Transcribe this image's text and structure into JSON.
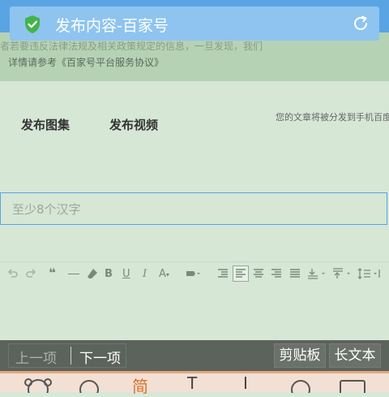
{
  "address_bar": {
    "title": "发布内容-百家号"
  },
  "notice": {
    "line1": "者若要违反法律法规及相关政策规定的信息，一旦发现，我们",
    "line2": "详情请参考《百家号平台服务协议》"
  },
  "tabs": {
    "gallery": "发布图集",
    "video": "发布视频"
  },
  "hint": "您的文章将被分发到手机百度",
  "title_input": {
    "placeholder": "至少8个汉字"
  },
  "editor_toolbar": {
    "icons": [
      "undo-icon",
      "redo-icon",
      "quote-icon",
      "hr-icon",
      "eraser-icon",
      "bold-icon",
      "underline-icon",
      "italic-icon",
      "font-color-icon",
      "highlight-icon",
      "indent-icon",
      "align-left-icon",
      "align-center-icon",
      "align-right-icon",
      "align-justify-icon",
      "row-spacing-top-icon",
      "row-spacing-bottom-icon",
      "line-height-icon"
    ],
    "bold": "B",
    "underline": "U",
    "italic": "I",
    "font_color": "A"
  },
  "keyboard_bar": {
    "prev": "上一项",
    "next": "下一项",
    "clipboard": "剪贴板",
    "long_text": "长文本"
  },
  "ime_bar": {
    "items": [
      "",
      "",
      "简",
      "T",
      "I",
      "",
      ""
    ]
  },
  "colors": {
    "accent": "#5aa4e3",
    "background": "#d6e7d6",
    "keyboard_bar": "#5c625c"
  }
}
